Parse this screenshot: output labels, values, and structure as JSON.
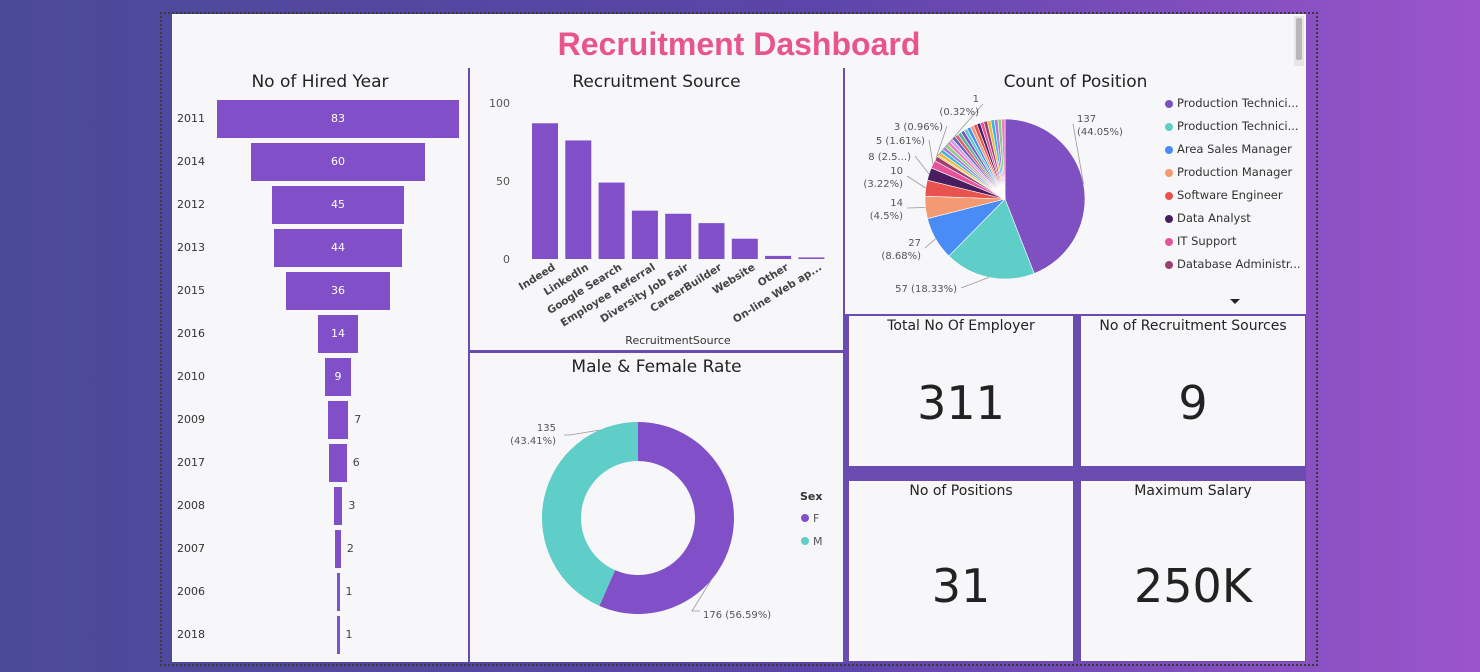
{
  "dashboard": {
    "title": "Recruitment Dashboard"
  },
  "colors": {
    "accent": "#8150c8",
    "teal": "#5fcdc8",
    "title": "#e8558e",
    "panel": "#f7f7fa"
  },
  "hired_year": {
    "title": "No of Hired Year",
    "chart_data": {
      "type": "bar",
      "categories": [
        "2011",
        "2014",
        "2012",
        "2013",
        "2015",
        "2016",
        "2010",
        "2009",
        "2017",
        "2008",
        "2007",
        "2006",
        "2018"
      ],
      "values": [
        83,
        60,
        45,
        44,
        36,
        14,
        9,
        7,
        6,
        3,
        2,
        1,
        1
      ]
    }
  },
  "recruitment_source": {
    "title": "Recruitment Source",
    "chart_data": {
      "type": "bar",
      "categories": [
        "Indeed",
        "LinkedIn",
        "Google Search",
        "Employee Referral",
        "Diversity Job Fair",
        "CareerBuilder",
        "Website",
        "Other",
        "On-line Web ap..."
      ],
      "values": [
        87,
        76,
        49,
        31,
        29,
        23,
        13,
        2,
        1
      ],
      "xlabel": "RecruitmentSource",
      "yticks": [
        "100",
        "50",
        "0"
      ],
      "ylim": [
        0,
        100
      ]
    }
  },
  "count_position": {
    "title": "Count of Position",
    "chart_data": {
      "type": "pie",
      "values": [
        137,
        57,
        27,
        14,
        10,
        8,
        5,
        3,
        1
      ],
      "labels": [
        "137\n(44.05%)",
        "57 (18.33%)",
        "27\n(8.68%)",
        "14\n(4.5%)",
        "10\n(3.22%)",
        "8 (2.5...)",
        "5 (1.61%)",
        "3 (0.96%)",
        "1\n(0.32%)"
      ],
      "legend": [
        {
          "name": "Production Technici...",
          "color": "#7e50c2"
        },
        {
          "name": "Production Technici...",
          "color": "#5fcdc8"
        },
        {
          "name": "Area Sales Manager",
          "color": "#4a8cf5"
        },
        {
          "name": "Production Manager",
          "color": "#f49a72"
        },
        {
          "name": "Software Engineer",
          "color": "#e8534f"
        },
        {
          "name": "Data Analyst",
          "color": "#4a1e5e"
        },
        {
          "name": "IT Support",
          "color": "#e5549a"
        },
        {
          "name": "Database Administr...",
          "color": "#9c3f72"
        }
      ]
    }
  },
  "gender": {
    "title": "Male & Female Rate",
    "chart_data": {
      "type": "pie",
      "series": [
        {
          "name": "F",
          "value": 176,
          "label": "176 (56.59%)",
          "color": "#8150c8"
        },
        {
          "name": "M",
          "value": 135,
          "label": "135\n(43.41%)",
          "color": "#5fcdc8"
        }
      ],
      "legend_title": "Sex"
    }
  },
  "kpis": {
    "employees": {
      "title": "Total No Of Employer",
      "value": "311"
    },
    "sources": {
      "title": "No of Recruitment Sources",
      "value": "9"
    },
    "positions": {
      "title": "No of Positions",
      "value": "31"
    },
    "salary": {
      "title": "Maximum Salary",
      "value": "250K"
    }
  }
}
